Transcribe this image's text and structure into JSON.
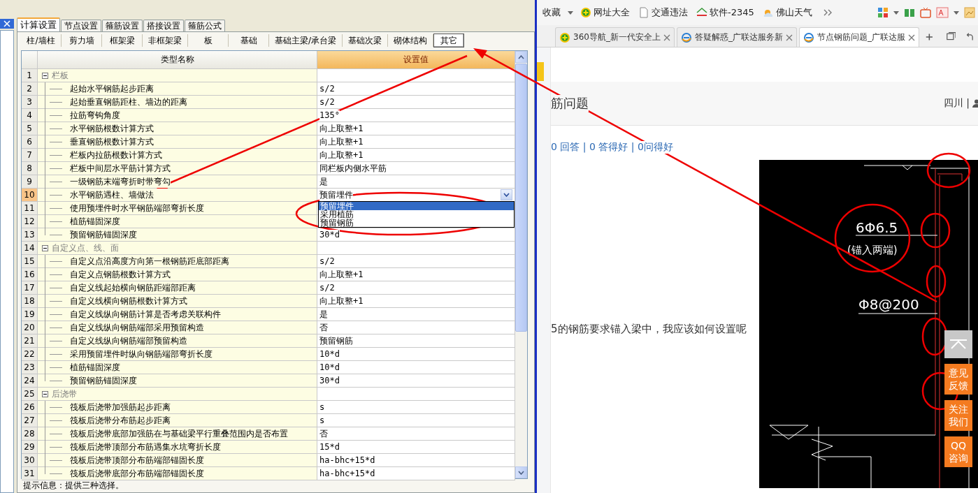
{
  "app": {
    "tabs": [
      {
        "label": "计算设置",
        "selected": true
      },
      {
        "label": "节点设置",
        "selected": false
      },
      {
        "label": "箍筋设置",
        "selected": false
      },
      {
        "label": "搭接设置",
        "selected": false
      },
      {
        "label": "箍筋公式",
        "selected": false
      }
    ],
    "sub_tabs": [
      {
        "label": "柱/墙柱",
        "selected": false
      },
      {
        "label": "剪力墙",
        "selected": false
      },
      {
        "label": "框架梁",
        "selected": false
      },
      {
        "label": "非框架梁",
        "selected": false
      },
      {
        "label": "板",
        "selected": false
      },
      {
        "label": "基础",
        "selected": false
      },
      {
        "label": "基础主梁/承台梁",
        "selected": false
      },
      {
        "label": "基础次梁",
        "selected": false
      },
      {
        "label": "砌体结构",
        "selected": false
      },
      {
        "label": "其它",
        "selected": true
      }
    ],
    "grid": {
      "columns": [
        "类型名称",
        "设置值"
      ],
      "groups": [
        {
          "number": "1",
          "name": "栏板",
          "expanded": true,
          "children": [
            {
              "number": "2",
              "name": "起始水平钢筋起步距离",
              "value": "s/2",
              "selected": false
            },
            {
              "number": "3",
              "name": "起始垂直钢筋距柱、墙边的距离",
              "value": "s/2",
              "selected": false
            },
            {
              "number": "4",
              "name": "拉筋弯钩角度",
              "value": "135°",
              "selected": false
            },
            {
              "number": "5",
              "name": "水平钢筋根数计算方式",
              "value": "向上取整+1",
              "selected": false
            },
            {
              "number": "6",
              "name": "垂直钢筋根数计算方式",
              "value": "向上取整+1",
              "selected": false
            },
            {
              "number": "7",
              "name": "栏板内拉筋根数计算方式",
              "value": "向上取整+1",
              "selected": false
            },
            {
              "number": "8",
              "name": "栏板中间层水平筋计算方式",
              "value": "同栏板内侧水平筋",
              "selected": false
            },
            {
              "number": "9",
              "name": "一级钢筋末端弯折时带弯勾",
              "value": "是",
              "selected": false
            },
            {
              "number": "10",
              "name": "水平钢筋遇柱、墙做法",
              "value": "预留埋件",
              "selected": true,
              "options": [
                {
                  "label": "预留埋件",
                  "selected": true
                },
                {
                  "label": "采用植筋",
                  "selected": false
                },
                {
                  "label": "预留钢筋",
                  "selected": false
                }
              ]
            },
            {
              "number": "11",
              "name": "使用预埋件时水平钢筋端部弯折长度",
              "selected": false
            },
            {
              "number": "12",
              "name": "植筋锚固深度",
              "selected": false
            },
            {
              "number": "13",
              "name": "预留钢筋锚固深度",
              "value": "30*d",
              "selected": false
            }
          ]
        },
        {
          "number": "14",
          "name": "自定义点、线、面",
          "expanded": true,
          "children": [
            {
              "number": "15",
              "name": "自定义点沿高度方向第一根钢筋距底部距离",
              "value": "s/2",
              "selected": false
            },
            {
              "number": "16",
              "name": "自定义点钢筋根数计算方式",
              "value": "向上取整+1",
              "selected": false
            },
            {
              "number": "17",
              "name": "自定义线起始横向钢筋距端部距离",
              "value": "s/2",
              "selected": false
            },
            {
              "number": "18",
              "name": "自定义线横向钢筋根数计算方式",
              "value": "向上取整+1",
              "selected": false
            },
            {
              "number": "19",
              "name": "自定义线纵向钢筋计算是否考虑关联构件",
              "value": "是",
              "selected": false
            },
            {
              "number": "20",
              "name": "自定义线纵向钢筋端部采用预留构造",
              "value": "否",
              "selected": false
            },
            {
              "number": "21",
              "name": "自定义线纵向钢筋端部预留构造",
              "value": "预留钢筋",
              "selected": false
            },
            {
              "number": "22",
              "name": "采用预留埋件时纵向钢筋端部弯折长度",
              "value": "10*d",
              "selected": false
            },
            {
              "number": "23",
              "name": "植筋锚固深度",
              "value": "10*d",
              "selected": false
            },
            {
              "number": "24",
              "name": "预留钢筋锚固深度",
              "value": "30*d",
              "selected": false
            }
          ]
        },
        {
          "number": "25",
          "name": "后浇带",
          "expanded": true,
          "children": [
            {
              "number": "26",
              "name": "筏板后浇带加强筋起步距离",
              "value": "s",
              "selected": false
            },
            {
              "number": "27",
              "name": "筏板后浇带分布筋起步距离",
              "value": "s",
              "selected": false
            },
            {
              "number": "28",
              "name": "筏板后浇带底部加强筋在与基础梁平行重叠范围内是否布置",
              "value": "否",
              "selected": false
            },
            {
              "number": "29",
              "name": "筏板后浇带顶部分布筋遇集水坑弯折长度",
              "value": "15*d",
              "selected": false
            },
            {
              "number": "30",
              "name": "筏板后浇带顶部分布筋端部锚固长度",
              "value": "ha-bhc+15*d",
              "selected": false
            },
            {
              "number": "31",
              "name": "筏板后浇带底部分布筋端部锚固长度",
              "value": "ha-bhc+15*d",
              "selected": false
            }
          ]
        }
      ]
    },
    "status": "提示信息：提供三种选择。"
  },
  "browser": {
    "bookmarks": [
      {
        "label": "收藏",
        "kind": "menu"
      },
      {
        "label": "网址大全",
        "kind": "nav"
      },
      {
        "label": "交通违法",
        "kind": "page"
      },
      {
        "label": "软件-2345",
        "kind": "house"
      },
      {
        "label": "佛山天气",
        "kind": "weather"
      }
    ],
    "tabs": [
      {
        "label": "360导航_新一代安全上",
        "kind": "nav",
        "selected": false
      },
      {
        "label": "答疑解惑_广联达服务新",
        "kind": "e",
        "selected": false
      },
      {
        "label": "节点钢筋问题_广联达服",
        "kind": "e",
        "selected": true
      }
    ],
    "page": {
      "title": "筋问题",
      "region": "四川 |",
      "stats": "0 回答 | 0 答得好 | 0问得好",
      "question": "5的钢筋要求锚入梁中，我应该如何设置呢",
      "drawing_labels": [
        "6Φ6.5",
        "(锚入两端)",
        "Φ8@200"
      ],
      "float_buttons": [
        {
          "kind": "top"
        },
        {
          "kind": "text",
          "label": "意见反馈"
        },
        {
          "kind": "text",
          "label": "关注我们"
        },
        {
          "kind": "text",
          "label": "QQ咨询"
        }
      ]
    }
  }
}
